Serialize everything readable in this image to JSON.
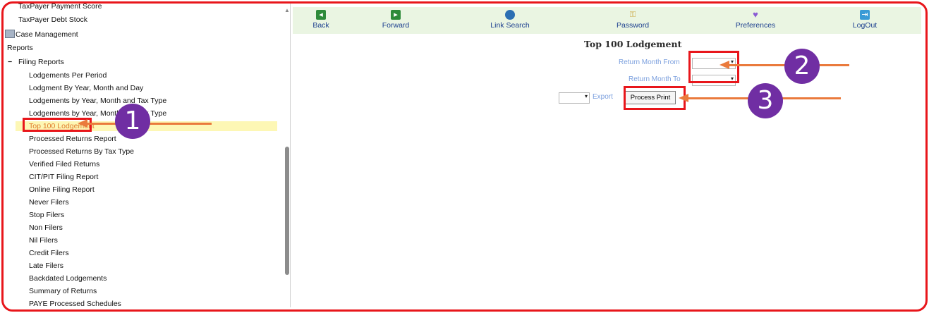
{
  "sidebar": {
    "items": [
      {
        "label": "TaxPayer Payment Score"
      },
      {
        "label": "TaxPayer Debt Stock"
      },
      {
        "label": "Case Management"
      },
      {
        "label": "Reports"
      },
      {
        "label": "Filing Reports",
        "toggle": "−"
      },
      {
        "label": "Lodgements Per Period"
      },
      {
        "label": "Lodgment By Year, Month and Day"
      },
      {
        "label": "Lodgements by Year, Month and Tax Type"
      },
      {
        "label": "Lodgements by Year, Month and Tax Type"
      },
      {
        "label": "Top 100 Lodgement",
        "selected": true
      },
      {
        "label": "Processed Returns Report"
      },
      {
        "label": "Processed Returns By Tax Type"
      },
      {
        "label": "Verified Filed Returns"
      },
      {
        "label": "CIT/PIT Filing Report"
      },
      {
        "label": "Online Filing Report"
      },
      {
        "label": "Never Filers"
      },
      {
        "label": "Stop Filers"
      },
      {
        "label": "Non Filers"
      },
      {
        "label": "Nil Filers"
      },
      {
        "label": "Credit Filers"
      },
      {
        "label": "Late Filers"
      },
      {
        "label": "Backdated Lodgements"
      },
      {
        "label": "Summary of Returns"
      },
      {
        "label": "PAYE Processed Schedules"
      }
    ]
  },
  "toolbar": {
    "buttons": [
      {
        "label": "Back",
        "icon": "back-arrow-icon",
        "color": "#2e8b3a"
      },
      {
        "label": "Forward",
        "icon": "forward-arrow-icon",
        "color": "#2e8b3a"
      },
      {
        "label": "Link Search",
        "icon": "globe-icon",
        "color": "#2c6fb3"
      },
      {
        "label": "Password",
        "icon": "key-icon",
        "color": "#c9a43a"
      },
      {
        "label": "Preferences",
        "icon": "heart-icon",
        "color": "#8a5bd3"
      },
      {
        "label": "LogOut",
        "icon": "logout-icon",
        "color": "#3a9bd6"
      }
    ]
  },
  "main": {
    "title": "Top 100 Lodgement",
    "return_month_from_label": "Return Month From",
    "return_month_to_label": "Return Month To",
    "export_label": "Export",
    "process_print_label": "Process Print"
  },
  "annotations": {
    "badges": [
      "1",
      "2",
      "3"
    ],
    "highlight_color": "#e8161b",
    "arrow_color": "#ea7a3c",
    "badge_color": "#702ea3"
  }
}
